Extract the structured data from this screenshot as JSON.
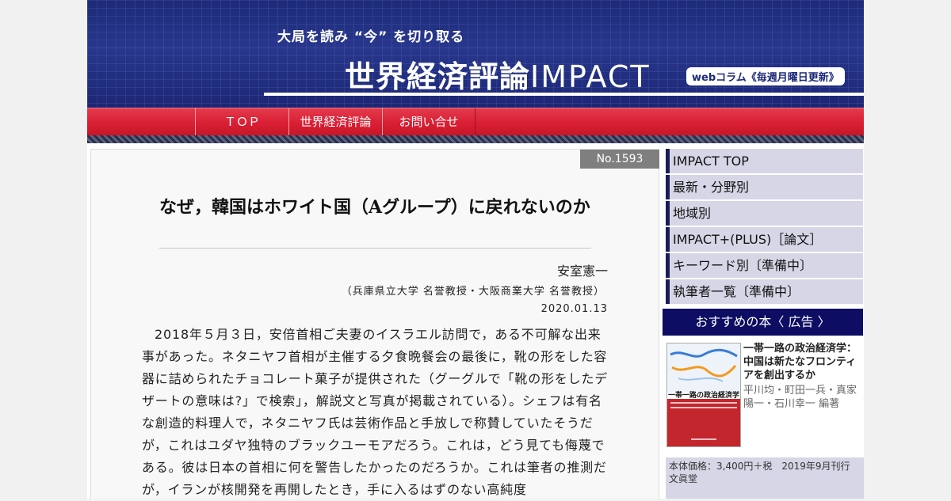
{
  "header": {
    "tagline": "大局を読み “今” を切り取る",
    "brand_jp": "世界経済評論",
    "brand_en": "IMPACT",
    "web_column": "webコラム《毎週月曜日更新》"
  },
  "nav": {
    "items": [
      {
        "label": "ＴＯＰ"
      },
      {
        "label": "世界経済評論"
      },
      {
        "label": "お問い合せ"
      }
    ]
  },
  "article": {
    "number": "No.1593",
    "title": "なぜ，韓国はホワイト国（Aグループ）に戻れないのか",
    "author": "安室憲一",
    "affiliation": "（兵庫県立大学 名誉教授・大阪商業大学 名誉教授）",
    "date": "2020.01.13",
    "body": "2018年５月３日，安倍首相ご夫妻のイスラエル訪問で，ある不可解な出来事があった。ネタニヤフ首相が主催する夕食晩餐会の最後に，靴の形をした容器に詰められたチョコレート菓子が提供された（グーグルで「靴の形をしたデザートの意味は?」で検索」，解説文と写真が掲載されている）。シェフは有名な創造的料理人で，ネタニヤフ氏は芸術作品と手放しで称賛していたそうだが，これはユダヤ独特のブラックユーモアだろう。これは，どう見ても侮蔑である。彼は日本の首相に何を警告したかったのだろうか。これは筆者の推測だが，イランが核開発を再開したとき，手に入るはずのない高純度"
  },
  "sidebar": {
    "menu": [
      {
        "label": "IMPACT TOP"
      },
      {
        "label": "最新・分野別"
      },
      {
        "label": "地域別"
      },
      {
        "label": "IMPACT+(PLUS)［論文］"
      },
      {
        "label": "キーワード別〔準備中〕"
      },
      {
        "label": "執筆者一覧〔準備中〕"
      }
    ],
    "ad_heading": "おすすめの本〈 広告 〉",
    "book": {
      "cover_title": "一帯一路の政治経済学",
      "title": "一帯一路の政治経済学：中国は新たなフロンティアを創出するか",
      "authors": "平川均・町田一兵・真家陽一・石川幸一 編著",
      "price": "本体価格：3,400円＋税　2019年9月刊行",
      "publisher": "文眞堂"
    }
  }
}
